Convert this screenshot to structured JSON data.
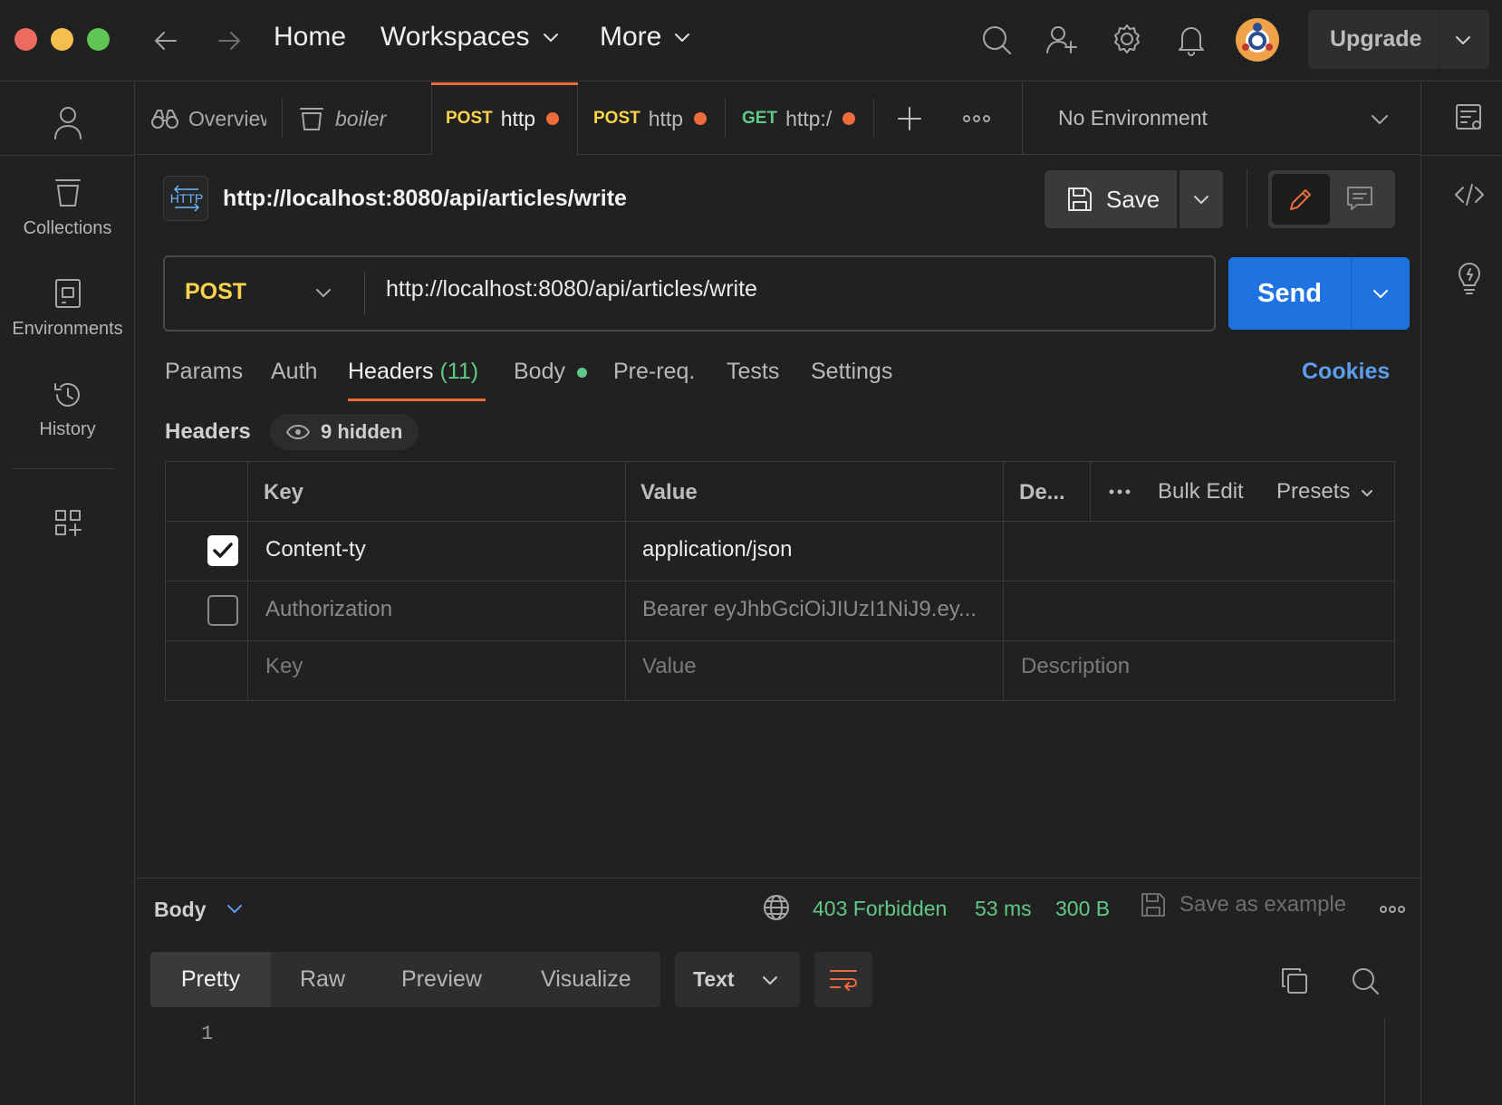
{
  "titlebar": {
    "home": "Home",
    "workspaces": "Workspaces",
    "more": "More",
    "upgrade": "Upgrade"
  },
  "sidebar": {
    "items": [
      {
        "label": "Collections",
        "icon": "collections-icon"
      },
      {
        "label": "Environments",
        "icon": "environments-icon"
      },
      {
        "label": "History",
        "icon": "history-icon"
      }
    ]
  },
  "tabs": {
    "overview": "Overview",
    "boiler": "boiler",
    "items": [
      {
        "method": "POST",
        "title": "http",
        "unsaved": true
      },
      {
        "method": "POST",
        "title": "http",
        "unsaved": true
      },
      {
        "method": "GET",
        "title": "http:/",
        "unsaved": true
      }
    ],
    "environment": "No Environment"
  },
  "request": {
    "title": "http://localhost:8080/api/articles/write",
    "save": "Save",
    "method": "POST",
    "url": "http://localhost:8080/api/articles/write",
    "send": "Send",
    "tabs": {
      "params": "Params",
      "auth": "Auth",
      "headers": "Headers",
      "headers_count": "(11)",
      "body": "Body",
      "prereq": "Pre-req.",
      "tests": "Tests",
      "settings": "Settings"
    },
    "cookies": "Cookies"
  },
  "headers": {
    "label": "Headers",
    "hidden": "9 hidden",
    "columns": {
      "key": "Key",
      "value": "Value",
      "description": "De...",
      "bulk_edit": "Bulk Edit",
      "presets": "Presets"
    },
    "rows": [
      {
        "checked": true,
        "key": "Content-ty",
        "value": "application/json"
      },
      {
        "checked": false,
        "key": "Authorization",
        "value": "Bearer eyJhbGciOiJIUzI1NiJ9.ey..."
      }
    ],
    "placeholder": {
      "key": "Key",
      "value": "Value",
      "description": "Description"
    }
  },
  "response": {
    "label": "Body",
    "status": "403 Forbidden",
    "time": "53 ms",
    "size": "300 B",
    "save_example": "Save as example",
    "tabs": {
      "pretty": "Pretty",
      "raw": "Raw",
      "preview": "Preview",
      "visualize": "Visualize"
    },
    "format": "Text",
    "line": "1"
  },
  "colors": {
    "accent": "#ee6c3b",
    "send": "#1f73e0",
    "post": "#fcd34d",
    "get": "#61c988",
    "status": "#61c988",
    "link": "#5c9ded"
  }
}
